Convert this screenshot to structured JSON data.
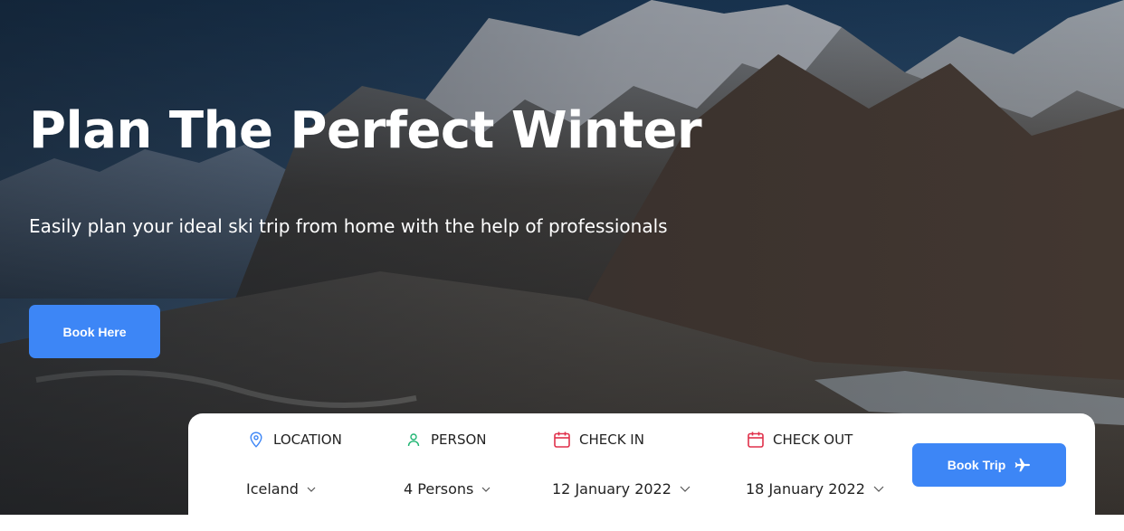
{
  "hero": {
    "title": "Plan The Perfect Winter",
    "subtitle": "Easily plan your ideal ski trip from home with the help of professionals",
    "cta_label": "Book Here",
    "background_image": "snowy mountain range"
  },
  "booking": {
    "fields": [
      {
        "label": "LOCATION",
        "value": "Iceland",
        "icon": "map-pin-icon",
        "icon_color": "#3d86f6"
      },
      {
        "label": "PERSON",
        "value": "4 Persons",
        "icon": "person-icon",
        "icon_color": "#21b573"
      },
      {
        "label": "CHECK IN",
        "value": "12 January 2022",
        "icon": "calendar-icon",
        "icon_color": "#e0314b"
      },
      {
        "label": "CHECK OUT",
        "value": "18 January 2022",
        "icon": "calendar-icon",
        "icon_color": "#e0314b"
      }
    ],
    "submit_label": "Book Trip",
    "submit_icon": "airplane-icon"
  },
  "colors": {
    "accent": "#3d86f6",
    "panel_bg": "#ffffff",
    "text_dark": "#222222"
  }
}
